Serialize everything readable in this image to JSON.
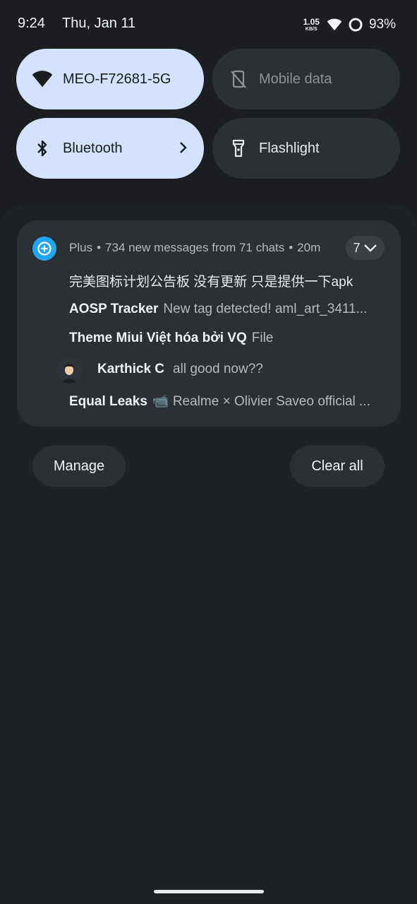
{
  "status_bar": {
    "time": "9:24",
    "date": "Thu, Jan 11",
    "net_speed_value": "1.05",
    "net_speed_unit": "KB/S",
    "battery": "93%"
  },
  "quick_settings": {
    "wifi": {
      "label": "MEO-F72681-5G",
      "icon": "wifi-icon",
      "active": true
    },
    "mobile_data": {
      "label": "Mobile data",
      "icon": "mobile-data-off-icon",
      "active": false
    },
    "bluetooth": {
      "label": "Bluetooth",
      "icon": "bluetooth-icon",
      "active": true
    },
    "flashlight": {
      "label": "Flashlight",
      "icon": "flashlight-icon",
      "active": false
    }
  },
  "notification": {
    "app_name": "Plus",
    "summary": "734 new messages from 71 chats",
    "time": "20m",
    "count": "7",
    "messages": [
      {
        "sender": "",
        "text": "完美图标计划公告板 没有更新 只是提供一下apk"
      },
      {
        "sender": "AOSP Tracker",
        "text": "New tag detected! aml_art_3411..."
      },
      {
        "sender": "Theme Miui Việt hóa bởi VQ",
        "text": "File"
      },
      {
        "sender": "Karthick C",
        "text": "all good now??"
      },
      {
        "sender": "Equal Leaks",
        "text": "📹 Realme × Olivier Saveo official ..."
      }
    ]
  },
  "buttons": {
    "manage": "Manage",
    "clear_all": "Clear all"
  },
  "colors": {
    "background": "#1b1d21",
    "tile_active": "#d3e3fd",
    "tile_inactive": "#2c2f33",
    "app_icon": "#23a5f0"
  }
}
